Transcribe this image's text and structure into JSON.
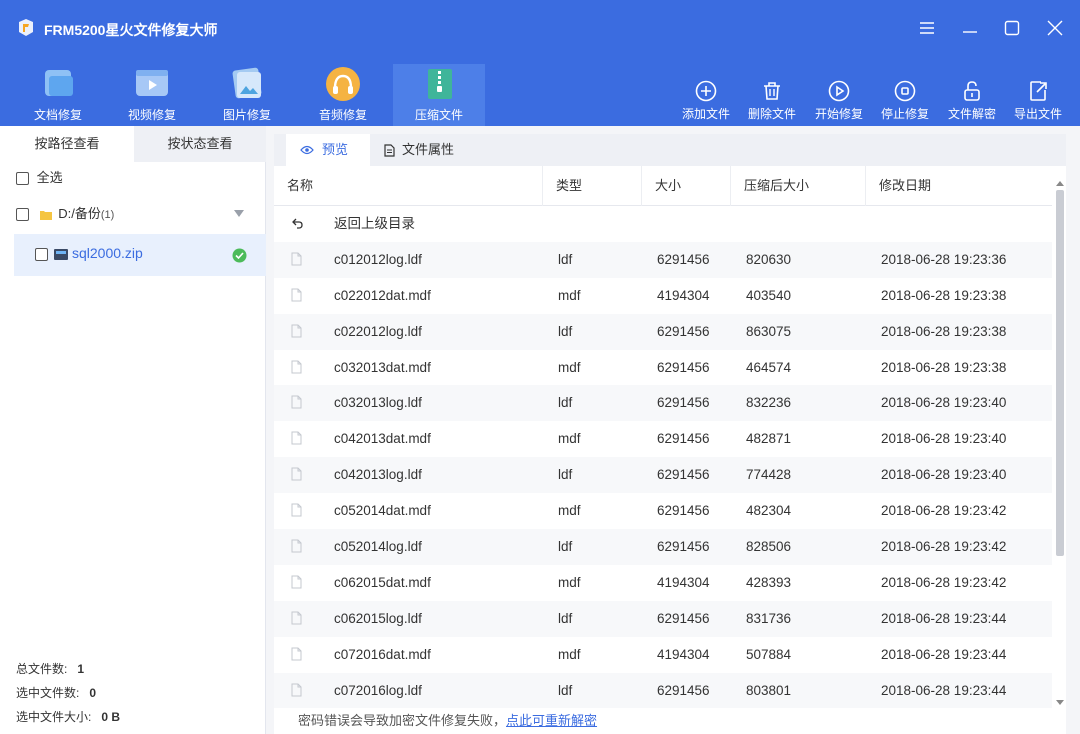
{
  "app": {
    "title": "FRM5200星火文件修复大师"
  },
  "nav": [
    {
      "label": "文档修复"
    },
    {
      "label": "视频修复"
    },
    {
      "label": "图片修复"
    },
    {
      "label": "音频修复"
    },
    {
      "label": "压缩文件"
    }
  ],
  "toolbar": [
    {
      "label": "添加文件",
      "icon": "plus-circle-icon"
    },
    {
      "label": "删除文件",
      "icon": "trash-icon"
    },
    {
      "label": "开始修复",
      "icon": "play-circle-icon"
    },
    {
      "label": "停止修复",
      "icon": "stop-circle-icon"
    },
    {
      "label": "文件解密",
      "icon": "unlock-icon"
    },
    {
      "label": "导出文件",
      "icon": "export-icon"
    }
  ],
  "left": {
    "tabs": [
      "按路径查看",
      "按状态查看"
    ],
    "select_all": "全选",
    "folder": {
      "name": "D:/备份",
      "count": "(1)"
    },
    "file": {
      "name": "sql2000.zip"
    },
    "stats": [
      {
        "label": "总文件数:",
        "value": "1"
      },
      {
        "label": "选中文件数:",
        "value": "0"
      },
      {
        "label": "选中文件大小:",
        "value": "0 B"
      }
    ]
  },
  "content_tabs": [
    "预览",
    "文件属性"
  ],
  "table": {
    "headers": [
      "名称",
      "类型",
      "大小",
      "压缩后大小",
      "修改日期"
    ],
    "back_label": "返回上级目录",
    "rows": [
      {
        "name": "c012012log.ldf",
        "type": "ldf",
        "size": "6291456",
        "csize": "820630",
        "date": "2018-06-28 19:23:36"
      },
      {
        "name": "c022012dat.mdf",
        "type": "mdf",
        "size": "4194304",
        "csize": "403540",
        "date": "2018-06-28 19:23:38"
      },
      {
        "name": "c022012log.ldf",
        "type": "ldf",
        "size": "6291456",
        "csize": "863075",
        "date": "2018-06-28 19:23:38"
      },
      {
        "name": "c032013dat.mdf",
        "type": "mdf",
        "size": "6291456",
        "csize": "464574",
        "date": "2018-06-28 19:23:38"
      },
      {
        "name": "c032013log.ldf",
        "type": "ldf",
        "size": "6291456",
        "csize": "832236",
        "date": "2018-06-28 19:23:40"
      },
      {
        "name": "c042013dat.mdf",
        "type": "mdf",
        "size": "6291456",
        "csize": "482871",
        "date": "2018-06-28 19:23:40"
      },
      {
        "name": "c042013log.ldf",
        "type": "ldf",
        "size": "6291456",
        "csize": "774428",
        "date": "2018-06-28 19:23:40"
      },
      {
        "name": "c052014dat.mdf",
        "type": "mdf",
        "size": "6291456",
        "csize": "482304",
        "date": "2018-06-28 19:23:42"
      },
      {
        "name": "c052014log.ldf",
        "type": "ldf",
        "size": "6291456",
        "csize": "828506",
        "date": "2018-06-28 19:23:42"
      },
      {
        "name": "c062015dat.mdf",
        "type": "mdf",
        "size": "4194304",
        "csize": "428393",
        "date": "2018-06-28 19:23:42"
      },
      {
        "name": "c062015log.ldf",
        "type": "ldf",
        "size": "6291456",
        "csize": "831736",
        "date": "2018-06-28 19:23:44"
      },
      {
        "name": "c072016dat.mdf",
        "type": "mdf",
        "size": "4194304",
        "csize": "507884",
        "date": "2018-06-28 19:23:44"
      },
      {
        "name": "c072016log.ldf",
        "type": "ldf",
        "size": "6291456",
        "csize": "803801",
        "date": "2018-06-28 19:23:44"
      }
    ]
  },
  "status": {
    "message": "密码错误会导致加密文件修复失败，",
    "link": "点此可重新解密"
  },
  "colors": {
    "accent": "#3b6ce0",
    "success": "#4cbb5a"
  }
}
